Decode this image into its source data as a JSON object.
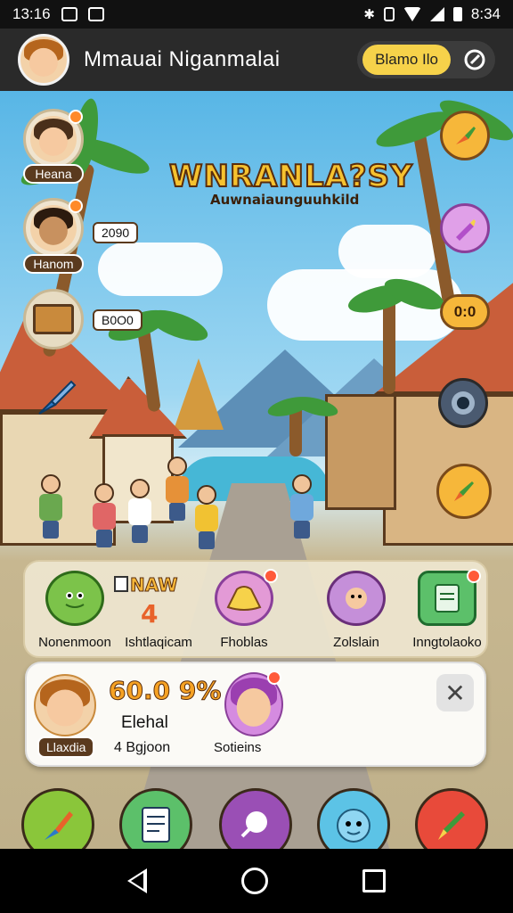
{
  "status_bar": {
    "time_left": "13:16",
    "time_right": "8:34"
  },
  "header": {
    "title": "Mmauai Niganmalai",
    "pill_label": "Blamo Ilo"
  },
  "game": {
    "title": "WNRANLA?SY",
    "subtitle": "Auwnaiaunguuhkild"
  },
  "left_panel": {
    "avatar_1_label": "Heana",
    "avatar_2_label": "Hanom",
    "avatar_2_count": "2090",
    "chest_count": "B0O0"
  },
  "right_panel": {
    "counter_label": "0:0"
  },
  "items": [
    {
      "label": "Nonenmoon"
    },
    {
      "label": "Ishtlaqicam",
      "new_tag": "NAW",
      "new_number": "4"
    },
    {
      "label": "Fhoblas"
    },
    {
      "label": "Zolslain"
    },
    {
      "label": "Inngtolaoko"
    }
  ],
  "profile_card": {
    "percent": "60.0 9%",
    "line1": "Elehal",
    "line2": "4 Bgjoon",
    "name_badge": "Llaxdia",
    "character_label": "Sotieins",
    "close_glyph": "✕"
  },
  "colors": {
    "accent_yellow": "#f6d24a",
    "header_bg": "#2a2a2a",
    "badge_red": "#ff5a3a"
  }
}
